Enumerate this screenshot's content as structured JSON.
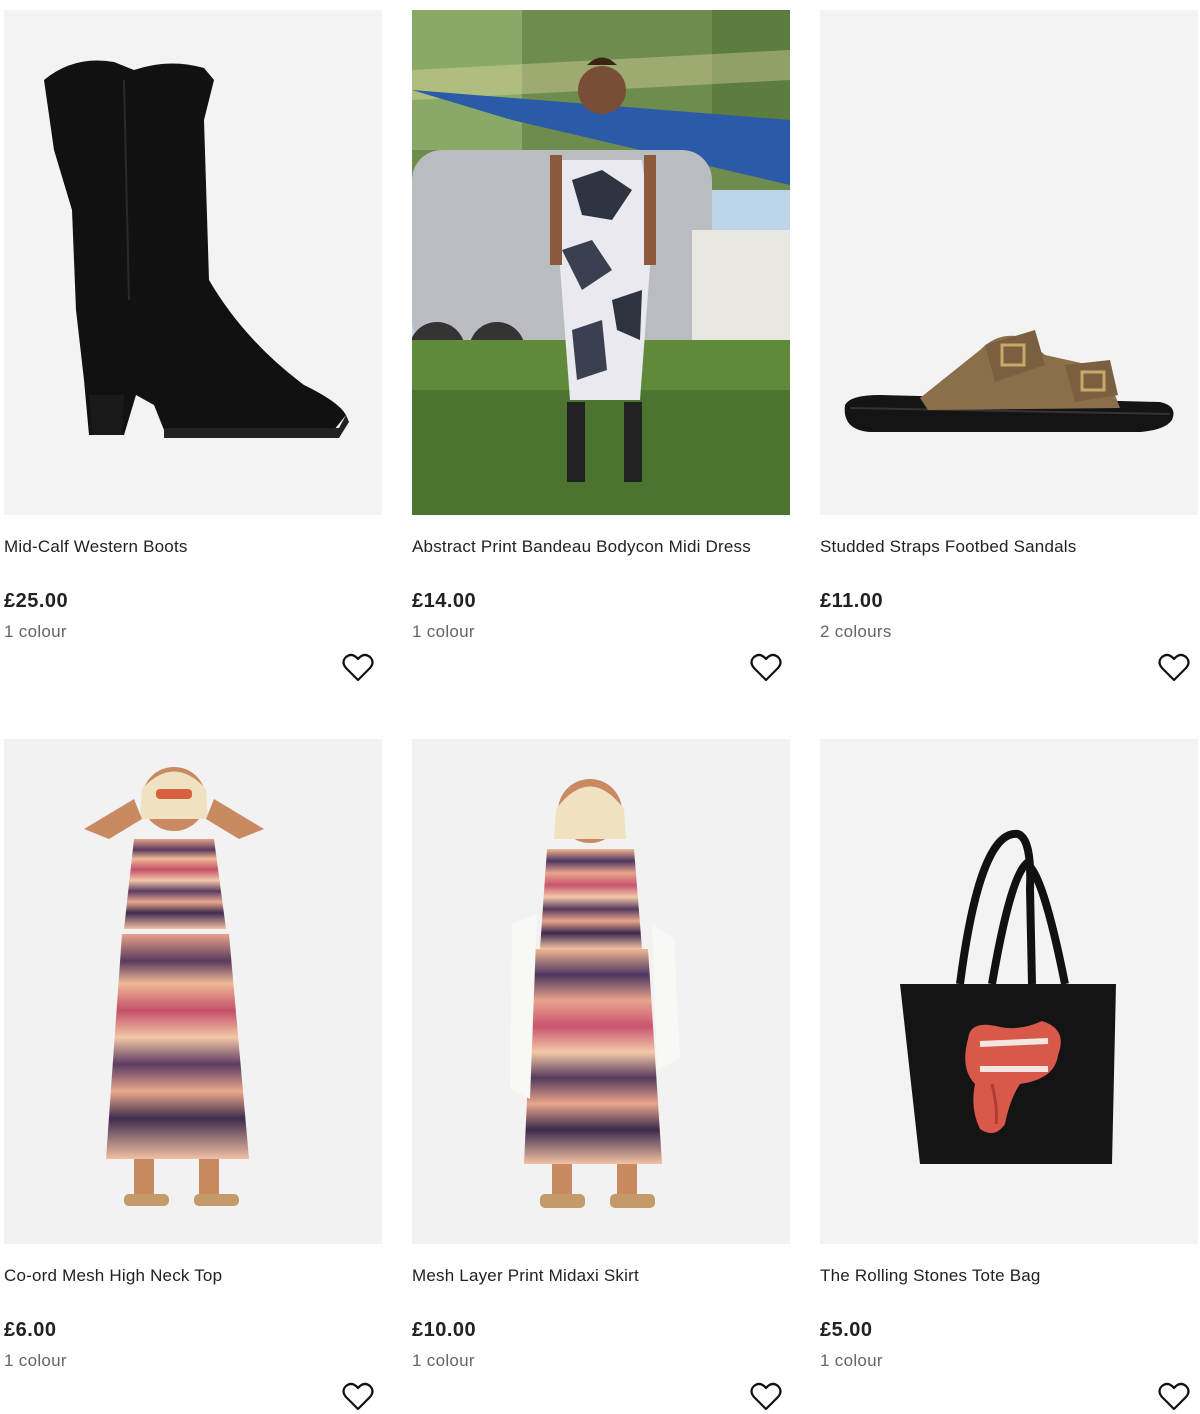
{
  "products": [
    {
      "title": "Mid-Calf Western Boots",
      "price": "£25.00",
      "colours": "1 colour",
      "image_icon": "western-boot-image"
    },
    {
      "title": "Abstract Print Bandeau Bodycon Midi Dress",
      "price": "£14.00",
      "colours": "1 colour",
      "image_icon": "model-dress-image"
    },
    {
      "title": "Studded Straps Footbed Sandals",
      "price": "£11.00",
      "colours": "2 colours",
      "image_icon": "sandal-image"
    },
    {
      "title": "Co-ord Mesh High Neck Top",
      "price": "£6.00",
      "colours": "1 colour",
      "image_icon": "model-top-image"
    },
    {
      "title": "Mesh Layer Print Midaxi Skirt",
      "price": "£10.00",
      "colours": "1 colour",
      "image_icon": "model-skirt-image"
    },
    {
      "title": "The Rolling Stones Tote Bag",
      "price": "£5.00",
      "colours": "1 colour",
      "image_icon": "tote-bag-image"
    }
  ],
  "icons": {
    "wishlist": "heart-icon"
  },
  "colors": {
    "text": "#222222",
    "muted": "#666666",
    "image_bg": "#f2f2f2"
  }
}
